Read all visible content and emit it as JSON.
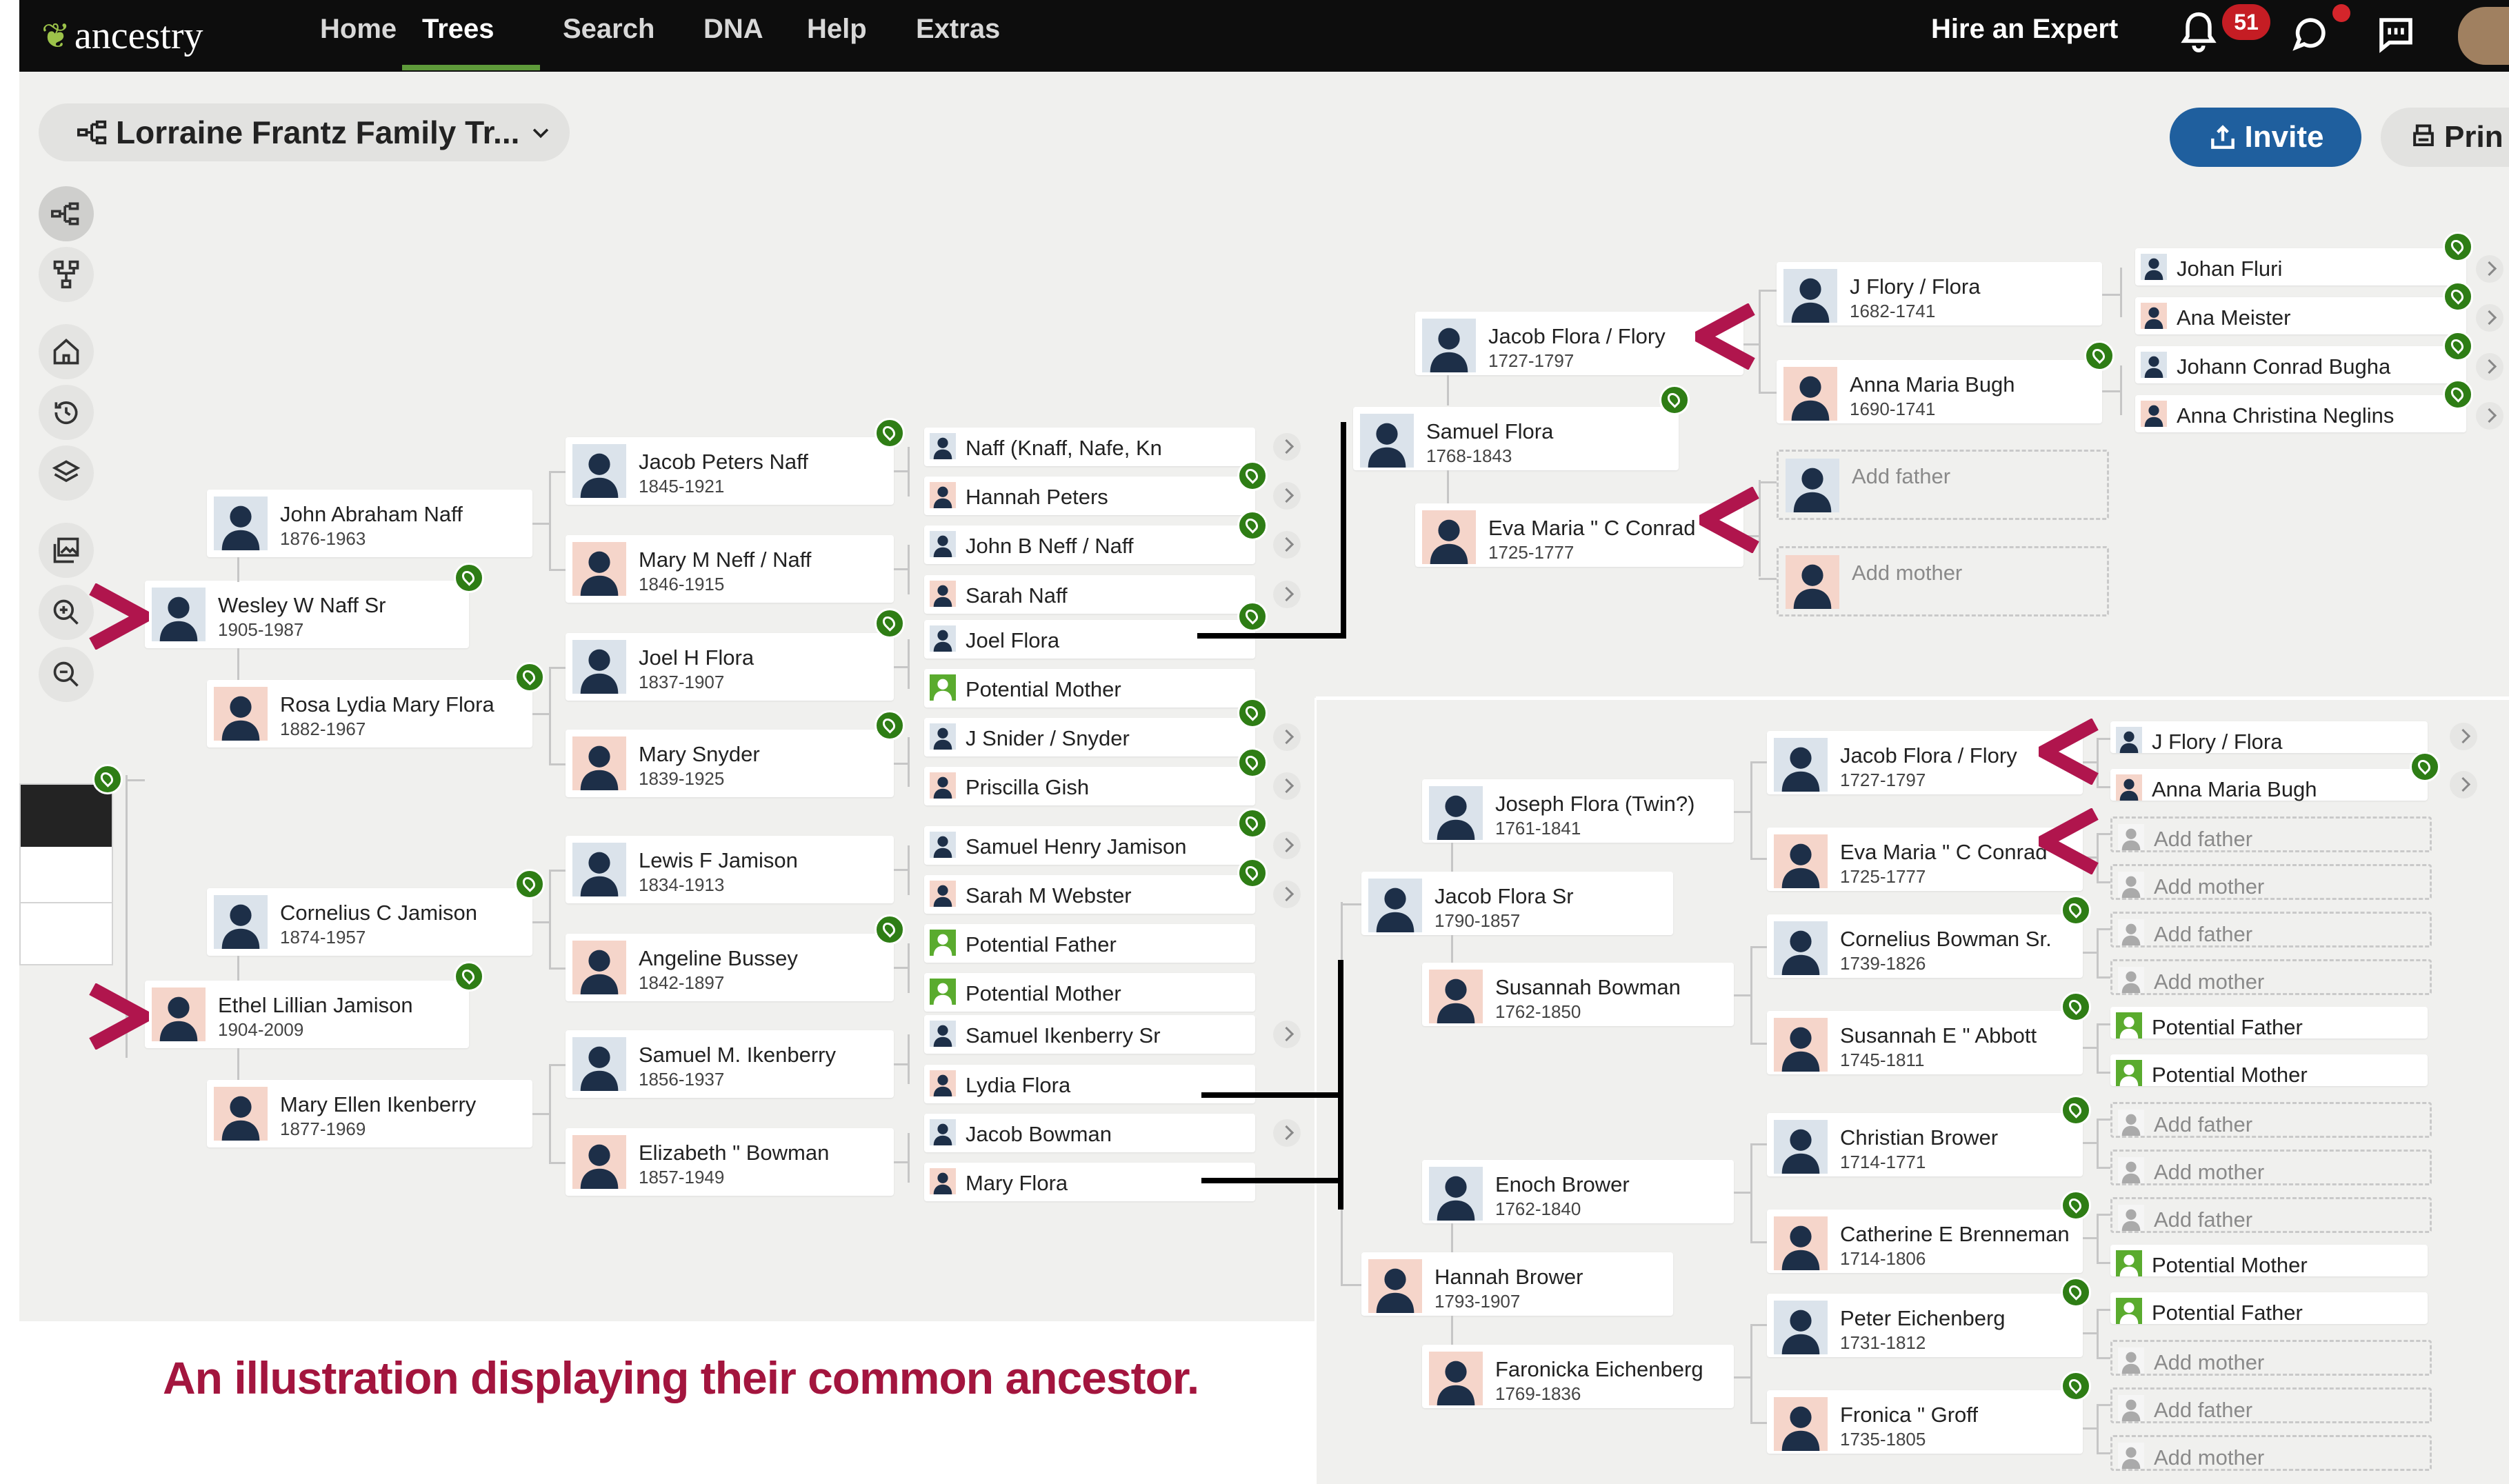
{
  "header": {
    "logo_text": "ancestry",
    "nav": [
      "Home",
      "Trees",
      "Search",
      "DNA",
      "Help",
      "Extras"
    ],
    "active_nav": "Trees",
    "hire_expert": "Hire an Expert",
    "notification_count": "51"
  },
  "toolbar": {
    "tree_name": "Lorraine Frantz Family Tr...",
    "invite_label": "Invite",
    "print_label": "Prin"
  },
  "tree": {
    "self": [
      {
        "name": "Wesley W Naff Sr",
        "dates": "1905-1987",
        "gender": "m"
      },
      {
        "name": "Ethel Lillian Jamison",
        "dates": "1904-2009",
        "gender": "f"
      }
    ],
    "parents": [
      {
        "name": "John Abraham Naff",
        "dates": "1876-1963",
        "gender": "m"
      },
      {
        "name": "Rosa Lydia Mary Flora",
        "dates": "1882-1967",
        "gender": "f"
      },
      {
        "name": "Cornelius C Jamison",
        "dates": "1874-1957",
        "gender": "m"
      },
      {
        "name": "Mary Ellen Ikenberry",
        "dates": "1877-1969",
        "gender": "f"
      }
    ],
    "grandparents": [
      {
        "name": "Jacob Peters Naff",
        "dates": "1845-1921",
        "gender": "m"
      },
      {
        "name": "Mary M Neff / Naff",
        "dates": "1846-1915",
        "gender": "f"
      },
      {
        "name": "Joel H Flora",
        "dates": "1837-1907",
        "gender": "m"
      },
      {
        "name": "Mary Snyder",
        "dates": "1839-1925",
        "gender": "f"
      },
      {
        "name": "Lewis F Jamison",
        "dates": "1834-1913",
        "gender": "m"
      },
      {
        "name": "Angeline Bussey",
        "dates": "1842-1897",
        "gender": "f"
      },
      {
        "name": "Samuel M. Ikenberry",
        "dates": "1856-1937",
        "gender": "m"
      },
      {
        "name": "Elizabeth \" Bowman",
        "dates": "1857-1949",
        "gender": "f"
      }
    ],
    "great_grandparents": [
      {
        "name": "Naff (Knaff, Nafe, Kn",
        "gender": "m"
      },
      {
        "name": "Hannah Peters",
        "gender": "f"
      },
      {
        "name": "John B Neff / Naff",
        "gender": "m"
      },
      {
        "name": "Sarah Naff",
        "gender": "f"
      },
      {
        "name": "Joel Flora",
        "gender": "m"
      },
      {
        "name": "Potential Mother",
        "gender": "potential"
      },
      {
        "name": "J Snider / Snyder",
        "gender": "m"
      },
      {
        "name": "Priscilla Gish",
        "gender": "f"
      },
      {
        "name": "Samuel Henry Jamison",
        "gender": "m"
      },
      {
        "name": "Sarah M Webster",
        "gender": "f"
      },
      {
        "name": "Potential Father",
        "gender": "potential"
      },
      {
        "name": "Potential Mother",
        "gender": "potential"
      },
      {
        "name": "Samuel Ikenberry Sr",
        "gender": "m"
      },
      {
        "name": "Lydia Flora",
        "gender": "f"
      },
      {
        "name": "Jacob Bowman",
        "gender": "m"
      },
      {
        "name": "Mary Flora",
        "gender": "f"
      }
    ],
    "upper_right": {
      "samuel": {
        "name": "Samuel Flora",
        "dates": "1768-1843"
      },
      "eva": {
        "name": "Eva Maria \" C Conrad",
        "dates": "1725-1777"
      },
      "jacob": {
        "name": "Jacob Flora / Flory",
        "dates": "1727-1797"
      },
      "jflory": {
        "name": "J Flory / Flora",
        "dates": "1682-1741"
      },
      "anna": {
        "name": "Anna Maria Bugh",
        "dates": "1690-1741"
      },
      "add_father": "Add father",
      "add_mother": "Add mother",
      "far": [
        "Johan Fluri",
        "Ana Meister",
        "Johann Conrad Bugha",
        "Anna Christina Neglins"
      ]
    },
    "inset": {
      "joseph": {
        "name": "Joseph Flora (Twin?)",
        "dates": "1761-1841"
      },
      "jacob_sr": {
        "name": "Jacob Flora Sr",
        "dates": "1790-1857"
      },
      "susannah": {
        "name": "Susannah Bowman",
        "dates": "1762-1850"
      },
      "enoch": {
        "name": "Enoch Brower",
        "dates": "1762-1840"
      },
      "hannah": {
        "name": "Hannah Brower",
        "dates": "1793-1907"
      },
      "faronicka": {
        "name": "Faronicka Eichenberg",
        "dates": "1769-1836"
      },
      "c3": [
        {
          "name": "Jacob Flora / Flory",
          "dates": "1727-1797",
          "gender": "m"
        },
        {
          "name": "Eva Maria \" C Conrad",
          "dates": "1725-1777",
          "gender": "f"
        },
        {
          "name": "Cornelius Bowman Sr.",
          "dates": "1739-1826",
          "gender": "m"
        },
        {
          "name": "Susannah E \" Abbott",
          "dates": "1745-1811",
          "gender": "f"
        },
        {
          "name": "Christian Brower",
          "dates": "1714-1771",
          "gender": "m"
        },
        {
          "name": "Catherine E Brenneman",
          "dates": "1714-1806",
          "gender": "f"
        },
        {
          "name": "Peter Eichenberg",
          "dates": "1731-1812",
          "gender": "m"
        },
        {
          "name": "Fronica \" Groff",
          "dates": "1735-1805",
          "gender": "f"
        }
      ],
      "c4": [
        {
          "name": "J Flory / Flora",
          "kind": "m"
        },
        {
          "name": "Anna Maria Bugh",
          "kind": "f"
        },
        {
          "name": "Add father",
          "kind": "add-m"
        },
        {
          "name": "Add mother",
          "kind": "add-f"
        },
        {
          "name": "Add father",
          "kind": "add-m"
        },
        {
          "name": "Add mother",
          "kind": "add-f"
        },
        {
          "name": "Potential Father",
          "kind": "potential"
        },
        {
          "name": "Potential Mother",
          "kind": "potential"
        },
        {
          "name": "Add father",
          "kind": "add-m"
        },
        {
          "name": "Add mother",
          "kind": "add-f"
        },
        {
          "name": "Add father",
          "kind": "add-m"
        },
        {
          "name": "Potential Mother",
          "kind": "potential"
        },
        {
          "name": "Potential Father",
          "kind": "potential"
        },
        {
          "name": "Add mother",
          "kind": "add-f"
        },
        {
          "name": "Add father",
          "kind": "add-m"
        },
        {
          "name": "Add mother",
          "kind": "add-f"
        }
      ]
    }
  },
  "caption": "An illustration displaying their common ancestor.",
  "colors": {
    "male": "#6f8fae",
    "female": "#d9582b",
    "potential": "#5aab2e",
    "hint": "#2e7d15",
    "marker": "#b0154d",
    "invite": "#1f5f9e"
  }
}
